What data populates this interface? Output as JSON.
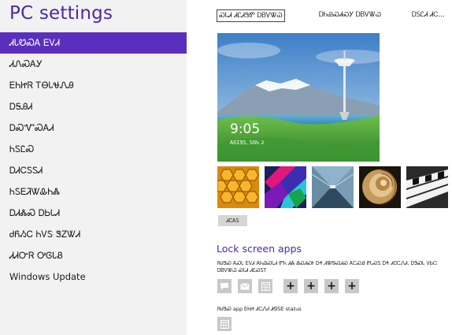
{
  "app": {
    "title": "PC settings"
  },
  "nav": {
    "items": [
      {
        "label": "ᏗᏓᏬᏍᎪ ᎬᏙᏗ"
      },
      {
        "label": "ᏗᏁᏍᎪᎩ"
      },
      {
        "label": "ᎬᏂᏥᏒ ᎢᎾᏓᏠᏁᎯ"
      },
      {
        "label": "ᎠᎦᎯᏗ"
      },
      {
        "label": "ᎠᏍᏉᏍᎪᏗ"
      },
      {
        "label": "ᏂᏚᏝᏍ"
      },
      {
        "label": "ᎠᏗᏟᏚᏚᏗ"
      },
      {
        "label": "ᏂᏚᎬᏘᏔᎲᏂᏜ"
      },
      {
        "label": "ᎠᏗᏜᏍ ᎠᏏᏓᏗ"
      },
      {
        "label": "ᏧᏲᏱᏟ ᏂᏙᏚ ᏕᏃᏔᏗ"
      },
      {
        "label": "ᏗᏗᏅᏒ ᎤᎶᏓᏰ"
      },
      {
        "label": "Windows Update"
      }
    ]
  },
  "tabs": [
    {
      "label": "ᏍᏓᏗ ᏗᏝᏗᏕᏛ ᎠᏴᏙᏔᏇ"
    },
    {
      "label": "ᎠᏂᏯᏍᏗᏍᎩ ᎠᏴᏙᏔᏇ"
    },
    {
      "label": "ᎠᏚᏝᏗ ᏗᏟ..."
    }
  ],
  "lock_preview": {
    "time": "9:05",
    "date": "ᎪᏲᏆᏕᏚ, ᏚᎶᏂ 2"
  },
  "browse_button": {
    "label": "ᏗᏟᎪᏚ"
  },
  "lock_apps": {
    "title": "Lock screen apps",
    "description": "ᏒᏧᏕᏍ ᎪᏍᏓ ᎬᏙᏗ ᎪᏂᏯᏍᏓᏗ ᏛᏂ ᏗᏜ ᏰᏍᏗᏍᎨ ᎠᏎ ᏗᏔᏫᏍᏗᏍ ᎪᏟᏍᎯ ᏑᏓᏍᏚ ᎠᏎ ᏗᏣᏟᏁᏗ, ᎠᏕᏍᏓ ᏙᏏᏨ ᎠᏴᏙᏔᏇ ᏍᏓᏗ ᏗᏝᏍᏚᎢ",
    "slots": [
      {
        "icon": "speech-bubble-icon"
      },
      {
        "icon": "mail-icon"
      },
      {
        "icon": "calendar-icon"
      },
      {
        "icon": "plus-icon",
        "label": "+"
      },
      {
        "icon": "plus-icon",
        "label": "+"
      },
      {
        "icon": "plus-icon",
        "label": "+"
      },
      {
        "icon": "plus-icon",
        "label": "+"
      }
    ],
    "detail_label": "ᏒᏧᏕᏍ app ᎬᏂᏥ ᏗᏟᏁᏗ ᏗᏫᏚᎬ status",
    "detail_slot": {
      "icon": "calendar-icon"
    }
  },
  "colors": {
    "accent": "#4b2aa5",
    "selected_bg": "#5b2fbd",
    "sidebar_bg": "#f2f2f2",
    "slot_bg": "#c8c8c8"
  }
}
